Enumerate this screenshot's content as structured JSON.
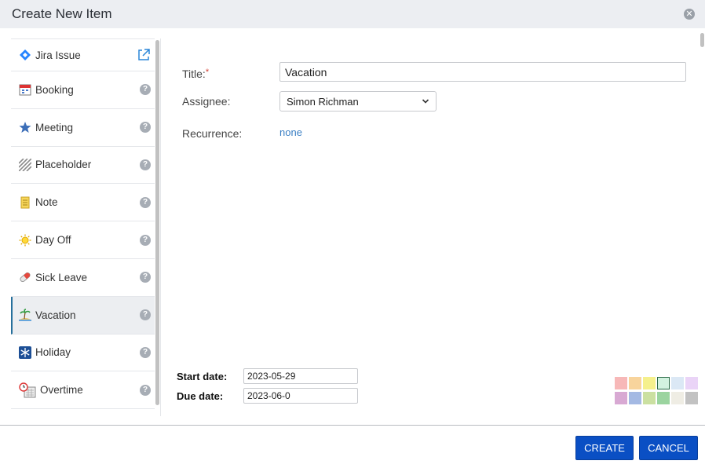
{
  "dialog": {
    "title": "Create New Item",
    "close_icon": "close-icon"
  },
  "sidebar": {
    "items": [
      {
        "label": "Jira Issue",
        "icon": "jira-diamond-icon",
        "action_icon": "external-link-icon"
      },
      {
        "label": "Booking",
        "icon": "calendar-booking-icon",
        "action_icon": "help-icon"
      },
      {
        "label": "Meeting",
        "icon": "star-icon",
        "action_icon": "help-icon"
      },
      {
        "label": "Placeholder",
        "icon": "striped-placeholder-icon",
        "action_icon": "help-icon"
      },
      {
        "label": "Note",
        "icon": "note-icon",
        "action_icon": "help-icon"
      },
      {
        "label": "Day Off",
        "icon": "sun-icon",
        "action_icon": "help-icon"
      },
      {
        "label": "Sick Leave",
        "icon": "pill-icon",
        "action_icon": "help-icon"
      },
      {
        "label": "Vacation",
        "icon": "island-icon",
        "action_icon": "help-icon",
        "active": true
      },
      {
        "label": "Holiday",
        "icon": "snowflake-icon",
        "action_icon": "help-icon"
      },
      {
        "label": "Overtime",
        "icon": "clock-calendar-icon",
        "action_icon": "help-icon"
      }
    ],
    "help_glyph": "?"
  },
  "form": {
    "title_label": "Title:",
    "required_mark": "*",
    "title_value": "Vacation",
    "assignee_label": "Assignee:",
    "assignee_value": "Simon Richman",
    "recurrence_label": "Recurrence:",
    "recurrence_value": "none",
    "start_date_label": "Start date:",
    "start_date_value": "2023-05-29",
    "due_date_label": "Due date:",
    "due_date_value": "2023-06-0"
  },
  "colors": {
    "swatches": [
      "#f7b8b8",
      "#f8d49c",
      "#f5f08c",
      "#d2f2e0",
      "#dbe8f5",
      "#ead4f7",
      "#d8a9d3",
      "#a4b9e3",
      "#cbe0a1",
      "#9bd49f",
      "#efede4",
      "#c2c2c2"
    ],
    "selected_index": 3,
    "accent": "#0a4fc4",
    "link": "#3a7fc4"
  },
  "footer": {
    "create_label": "CREATE",
    "cancel_label": "CANCEL"
  }
}
